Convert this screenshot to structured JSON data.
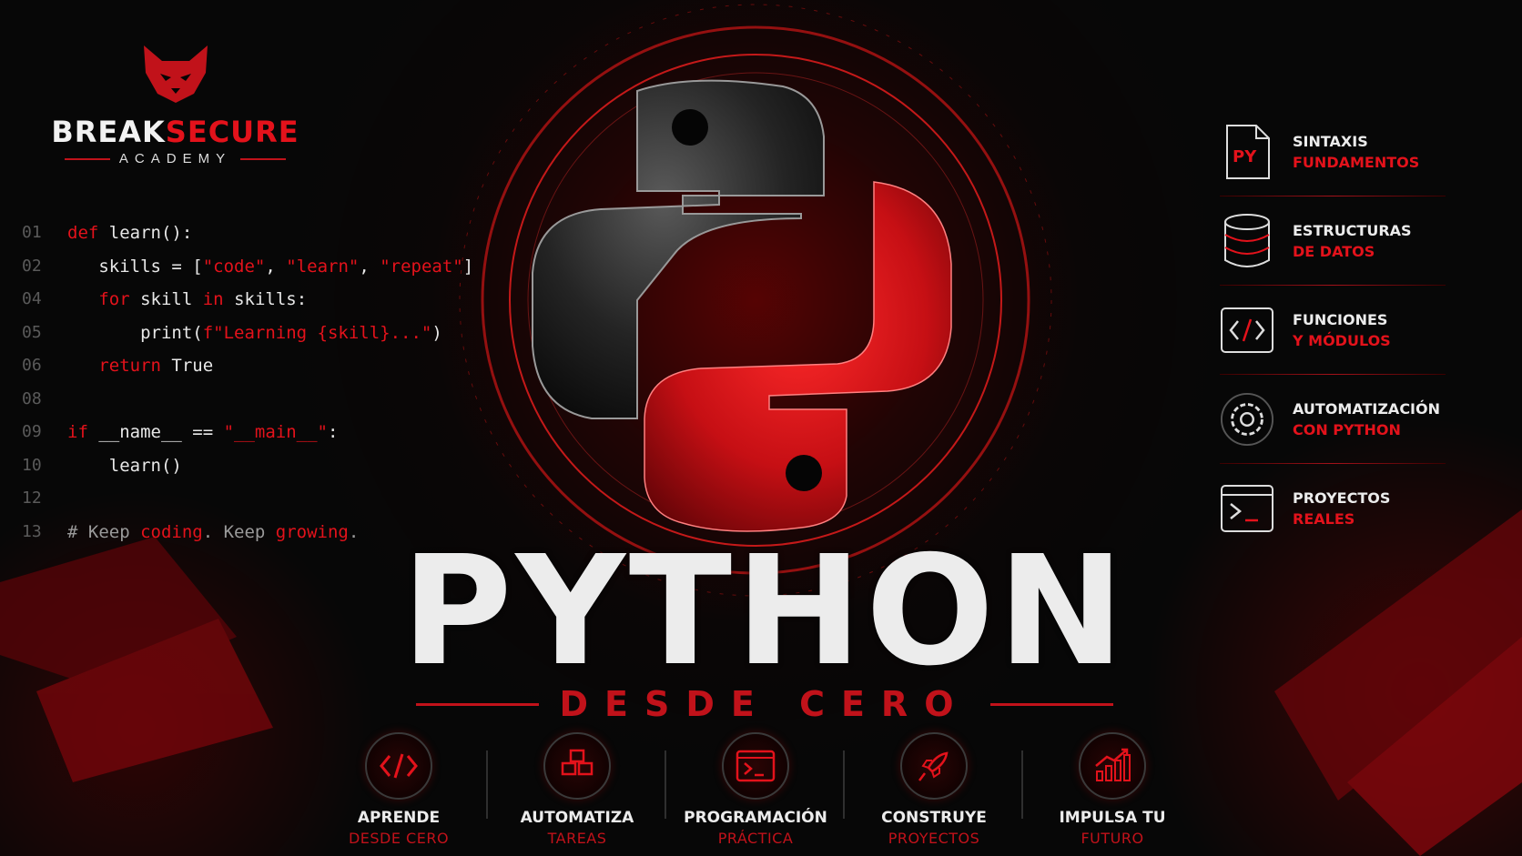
{
  "brand": {
    "part1": "BREAK",
    "part2": "SECURE",
    "academy": "ACADEMY"
  },
  "code": [
    {
      "n": "01",
      "html": "<span class=\"kw\">def</span><span class=\"t\"> learn():</span>"
    },
    {
      "n": "02",
      "html": "<span class=\"t\">   skills = [</span><span class=\"str\">\"code\"</span><span class=\"t\">, </span><span class=\"str\">\"learn\"</span><span class=\"t\">, </span><span class=\"str\">\"repeat\"</span><span class=\"t\">]</span>"
    },
    {
      "n": "04",
      "html": "<span class=\"t\">   </span><span class=\"kw\">for</span><span class=\"t\"> skill </span><span class=\"kw\">in</span><span class=\"t\"> skills:</span>"
    },
    {
      "n": "05",
      "html": "<span class=\"t\">       print(</span><span class=\"str\">f\"Learning {skill}...\"</span><span class=\"t\">)</span>"
    },
    {
      "n": "06",
      "html": "<span class=\"t\">   </span><span class=\"kw\">return</span><span class=\"t\"> True</span>"
    },
    {
      "n": "08",
      "html": ""
    },
    {
      "n": "09",
      "html": "<span class=\"kw\">if</span><span class=\"t\"> __name__ == </span><span class=\"str\">\"__main__\"</span><span class=\"t\">:</span>"
    },
    {
      "n": "10",
      "html": "<span class=\"t\">    learn()</span>"
    },
    {
      "n": "12",
      "html": ""
    },
    {
      "n": "13",
      "html": "<span class=\"cm\"># Keep </span><span class=\"str\">coding</span><span class=\"cm\">. Keep </span><span class=\"str\">growing</span><span class=\"cm\">.</span>"
    }
  ],
  "title": "PYTHON",
  "subtitle": "DESDE CERO",
  "features": [
    {
      "icon": "py-file-icon",
      "l1": "SINTAXIS",
      "l2": "FUNDAMENTOS"
    },
    {
      "icon": "database-icon",
      "l1": "ESTRUCTURAS",
      "l2": "DE DATOS"
    },
    {
      "icon": "code-brackets-icon",
      "l1": "FUNCIONES",
      "l2": "Y MÓDULOS"
    },
    {
      "icon": "gear-icon",
      "l1": "AUTOMATIZACIÓN",
      "l2": "CON PYTHON"
    },
    {
      "icon": "terminal-icon",
      "l1": "PROYECTOS",
      "l2": "REALES"
    }
  ],
  "bottom": [
    {
      "icon": "code-brackets-icon",
      "l1": "APRENDE",
      "l2": "DESDE CERO"
    },
    {
      "icon": "cubes-icon",
      "l1": "AUTOMATIZA",
      "l2": "TAREAS"
    },
    {
      "icon": "terminal-window-icon",
      "l1": "PROGRAMACIÓN",
      "l2": "PRÁCTICA"
    },
    {
      "icon": "rocket-icon",
      "l1": "CONSTRUYE",
      "l2": "PROYECTOS"
    },
    {
      "icon": "growth-chart-icon",
      "l1": "IMPULSA TU",
      "l2": "FUTURO"
    }
  ],
  "colors": {
    "accent": "#e3121b",
    "dark": "#070707",
    "text": "#ececec"
  }
}
